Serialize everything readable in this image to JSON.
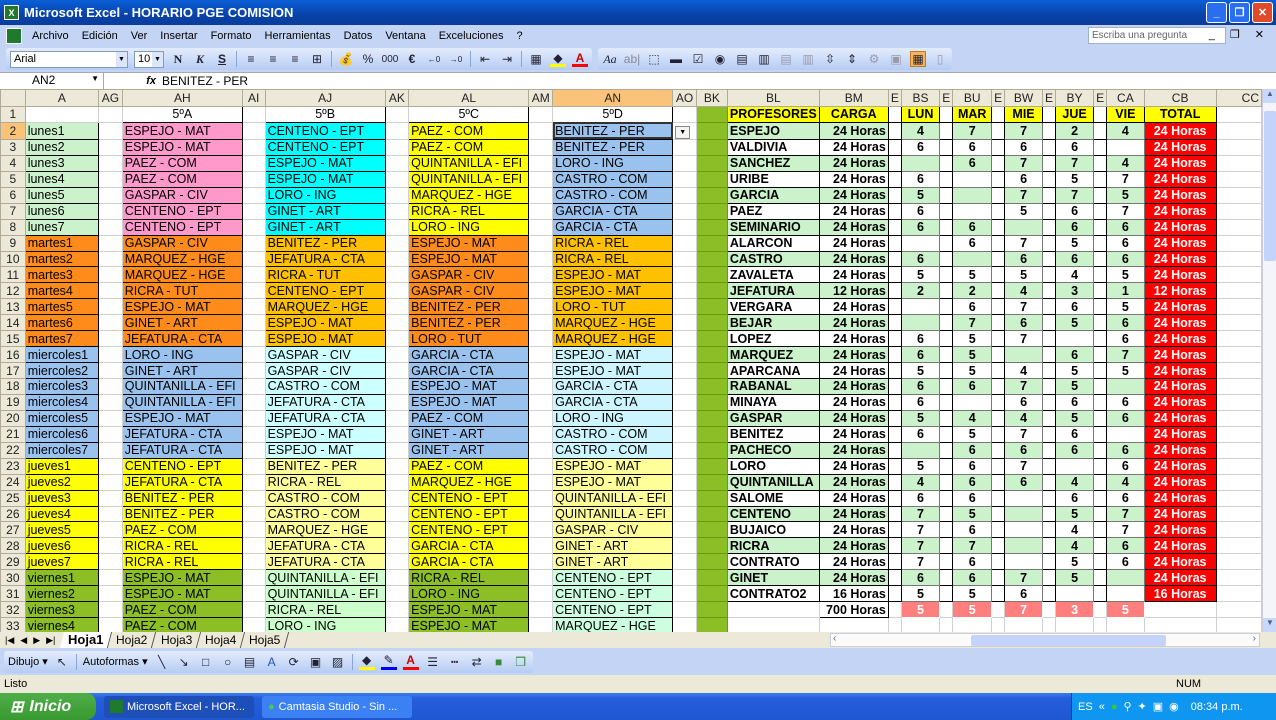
{
  "window": {
    "title": "Microsoft Excel - HORARIO PGE COMISION"
  },
  "menu": {
    "items": [
      "Archivo",
      "Edición",
      "Ver",
      "Insertar",
      "Formato",
      "Herramientas",
      "Datos",
      "Ventana",
      "Exceluciones",
      "?"
    ],
    "ask_placeholder": "Escriba una pregunta"
  },
  "format_toolbar": {
    "font": "Arial",
    "size": "10",
    "bold": "N",
    "italic": "K",
    "underline": "S",
    "percent": "%",
    "thousands": "000",
    "euro": "€"
  },
  "formula_bar": {
    "name_box": "AN2",
    "fx": "fx",
    "value": "BENITEZ - PER"
  },
  "columns": {
    "left": [
      "A",
      "AG",
      "AH",
      "AI",
      "AJ",
      "AK",
      "AL",
      "AM",
      "AN",
      "AO",
      "BK"
    ],
    "right": [
      "BL",
      "BM",
      "E",
      "BS",
      "E",
      "BU",
      "E",
      "BW",
      "E",
      "BY",
      "E",
      "CA",
      "CB",
      "CC"
    ]
  },
  "classes": [
    "5ºA",
    "5ºB",
    "5ºC",
    "5ºD"
  ],
  "rows": [
    {
      "n": "2",
      "slot": "lunes1",
      "a": "ESPEJO - MAT",
      "b": "CENTENO - EPT",
      "c": "PAEZ - COM",
      "d": "BENITEZ - PER"
    },
    {
      "n": "3",
      "slot": "lunes2",
      "a": "ESPEJO - MAT",
      "b": "CENTENO - EPT",
      "c": "PAEZ - COM",
      "d": "BENITEZ - PER"
    },
    {
      "n": "4",
      "slot": "lunes3",
      "a": "PAEZ - COM",
      "b": "ESPEJO - MAT",
      "c": "QUINTANILLA - EFI",
      "d": "LORO - ING"
    },
    {
      "n": "5",
      "slot": "lunes4",
      "a": "PAEZ - COM",
      "b": "ESPEJO - MAT",
      "c": "QUINTANILLA - EFI",
      "d": "CASTRO - COM"
    },
    {
      "n": "6",
      "slot": "lunes5",
      "a": "GASPAR - CIV",
      "b": "LORO - ING",
      "c": "MARQUEZ - HGE",
      "d": "CASTRO - COM"
    },
    {
      "n": "7",
      "slot": "lunes6",
      "a": "CENTENO - EPT",
      "b": "GINET - ART",
      "c": "RICRA - REL",
      "d": "GARCIA - CTA"
    },
    {
      "n": "8",
      "slot": "lunes7",
      "a": "CENTENO - EPT",
      "b": "GINET - ART",
      "c": "LORO - ING",
      "d": "GARCIA - CTA"
    },
    {
      "n": "9",
      "slot": "martes1",
      "a": "GASPAR - CIV",
      "b": "BENITEZ - PER",
      "c": "ESPEJO - MAT",
      "d": "RICRA - REL"
    },
    {
      "n": "10",
      "slot": "martes2",
      "a": "MARQUEZ - HGE",
      "b": "JEFATURA - CTA",
      "c": "ESPEJO - MAT",
      "d": "RICRA - REL"
    },
    {
      "n": "11",
      "slot": "martes3",
      "a": "MARQUEZ - HGE",
      "b": "RICRA - TUT",
      "c": "GASPAR - CIV",
      "d": "ESPEJO - MAT"
    },
    {
      "n": "12",
      "slot": "martes4",
      "a": "RICRA - TUT",
      "b": "CENTENO - EPT",
      "c": "GASPAR - CIV",
      "d": "ESPEJO - MAT"
    },
    {
      "n": "13",
      "slot": "martes5",
      "a": "ESPEJO - MAT",
      "b": "MARQUEZ - HGE",
      "c": "BENITEZ - PER",
      "d": "LORO - TUT"
    },
    {
      "n": "14",
      "slot": "martes6",
      "a": "GINET - ART",
      "b": "ESPEJO - MAT",
      "c": "BENITEZ - PER",
      "d": "MARQUEZ - HGE"
    },
    {
      "n": "15",
      "slot": "martes7",
      "a": "JEFATURA - CTA",
      "b": "ESPEJO - MAT",
      "c": "LORO - TUT",
      "d": "MARQUEZ - HGE"
    },
    {
      "n": "16",
      "slot": "miercoles1",
      "a": "LORO - ING",
      "b": "GASPAR - CIV",
      "c": "GARCIA - CTA",
      "d": "ESPEJO - MAT"
    },
    {
      "n": "17",
      "slot": "miercoles2",
      "a": "GINET - ART",
      "b": "GASPAR - CIV",
      "c": "GARCIA - CTA",
      "d": "ESPEJO - MAT"
    },
    {
      "n": "18",
      "slot": "miercoles3",
      "a": "QUINTANILLA - EFI",
      "b": "CASTRO - COM",
      "c": "ESPEJO - MAT",
      "d": "GARCIA - CTA"
    },
    {
      "n": "19",
      "slot": "miercoles4",
      "a": "QUINTANILLA - EFI",
      "b": "JEFATURA - CTA",
      "c": "ESPEJO - MAT",
      "d": "GARCIA - CTA"
    },
    {
      "n": "20",
      "slot": "miercoles5",
      "a": "ESPEJO - MAT",
      "b": "JEFATURA - CTA",
      "c": "PAEZ - COM",
      "d": "LORO - ING"
    },
    {
      "n": "21",
      "slot": "miercoles6",
      "a": "JEFATURA - CTA",
      "b": "ESPEJO - MAT",
      "c": "GINET - ART",
      "d": "CASTRO - COM"
    },
    {
      "n": "22",
      "slot": "miercoles7",
      "a": "JEFATURA - CTA",
      "b": "ESPEJO - MAT",
      "c": "GINET - ART",
      "d": "CASTRO - COM"
    },
    {
      "n": "23",
      "slot": "jueves1",
      "a": "CENTENO - EPT",
      "b": "BENITEZ - PER",
      "c": "PAEZ - COM",
      "d": "ESPEJO - MAT"
    },
    {
      "n": "24",
      "slot": "jueves2",
      "a": "JEFATURA - CTA",
      "b": "RICRA - REL",
      "c": "MARQUEZ - HGE",
      "d": "ESPEJO - MAT"
    },
    {
      "n": "25",
      "slot": "jueves3",
      "a": "BENITEZ - PER",
      "b": "CASTRO - COM",
      "c": "CENTENO - EPT",
      "d": "QUINTANILLA - EFI"
    },
    {
      "n": "26",
      "slot": "jueves4",
      "a": "BENITEZ - PER",
      "b": "CASTRO - COM",
      "c": "CENTENO - EPT",
      "d": "QUINTANILLA - EFI"
    },
    {
      "n": "27",
      "slot": "jueves5",
      "a": "PAEZ - COM",
      "b": "MARQUEZ - HGE",
      "c": "CENTENO - EPT",
      "d": "GASPAR - CIV"
    },
    {
      "n": "28",
      "slot": "jueves6",
      "a": "RICRA - REL",
      "b": "JEFATURA - CTA",
      "c": "GARCIA - CTA",
      "d": "GINET - ART"
    },
    {
      "n": "29",
      "slot": "jueves7",
      "a": "RICRA - REL",
      "b": "JEFATURA - CTA",
      "c": "GARCIA - CTA",
      "d": "GINET - ART"
    },
    {
      "n": "30",
      "slot": "viernes1",
      "a": "ESPEJO - MAT",
      "b": "QUINTANILLA - EFI",
      "c": "RICRA - REL",
      "d": "CENTENO - EPT"
    },
    {
      "n": "31",
      "slot": "viernes2",
      "a": "ESPEJO - MAT",
      "b": "QUINTANILLA - EFI",
      "c": "LORO - ING",
      "d": "CENTENO - EPT"
    },
    {
      "n": "32",
      "slot": "viernes3",
      "a": "PAEZ - COM",
      "b": "RICRA - REL",
      "c": "ESPEJO - MAT",
      "d": "CENTENO - EPT"
    },
    {
      "n": "33",
      "slot": "viernes4",
      "a": "PAEZ - COM",
      "b": "LORO - ING",
      "c": "ESPEJO - MAT",
      "d": "MARQUEZ - HGE"
    }
  ],
  "summary": {
    "headers": [
      "PROFESORES",
      "CARGA",
      "LUN",
      "MAR",
      "MIE",
      "JUE",
      "VIE",
      "TOTAL"
    ],
    "teachers": [
      {
        "name": "ESPEJO",
        "carga": "24 Horas",
        "lun": "4",
        "mar": "7",
        "mie": "7",
        "jue": "2",
        "vie": "4",
        "total": "24 Horas"
      },
      {
        "name": "VALDIVIA",
        "carga": "24 Horas",
        "lun": "6",
        "mar": "6",
        "mie": "6",
        "jue": "6",
        "vie": "",
        "total": "24 Horas"
      },
      {
        "name": "SANCHEZ",
        "carga": "24 Horas",
        "lun": "",
        "mar": "6",
        "mie": "7",
        "jue": "7",
        "vie": "4",
        "total": "24 Horas"
      },
      {
        "name": "URIBE",
        "carga": "24 Horas",
        "lun": "6",
        "mar": "",
        "mie": "6",
        "jue": "5",
        "vie": "7",
        "total": "24 Horas"
      },
      {
        "name": "GARCIA",
        "carga": "24 Horas",
        "lun": "5",
        "mar": "",
        "mie": "7",
        "jue": "7",
        "vie": "5",
        "total": "24 Horas"
      },
      {
        "name": "PAEZ",
        "carga": "24 Horas",
        "lun": "6",
        "mar": "",
        "mie": "5",
        "jue": "6",
        "vie": "7",
        "total": "24 Horas"
      },
      {
        "name": "SEMINARIO",
        "carga": "24 Horas",
        "lun": "6",
        "mar": "6",
        "mie": "",
        "jue": "6",
        "vie": "6",
        "total": "24 Horas"
      },
      {
        "name": "ALARCON",
        "carga": "24 Horas",
        "lun": "",
        "mar": "6",
        "mie": "7",
        "jue": "5",
        "vie": "6",
        "total": "24 Horas"
      },
      {
        "name": "CASTRO",
        "carga": "24 Horas",
        "lun": "6",
        "mar": "",
        "mie": "6",
        "jue": "6",
        "vie": "6",
        "total": "24 Horas"
      },
      {
        "name": "ZAVALETA",
        "carga": "24 Horas",
        "lun": "5",
        "mar": "5",
        "mie": "5",
        "jue": "4",
        "vie": "5",
        "total": "24 Horas"
      },
      {
        "name": "JEFATURA",
        "carga": "12 Horas",
        "lun": "2",
        "mar": "2",
        "mie": "4",
        "jue": "3",
        "vie": "1",
        "total": "12 Horas"
      },
      {
        "name": "VERGARA",
        "carga": "24 Horas",
        "lun": "",
        "mar": "6",
        "mie": "7",
        "jue": "6",
        "vie": "5",
        "total": "24 Horas"
      },
      {
        "name": "BEJAR",
        "carga": "24 Horas",
        "lun": "",
        "mar": "7",
        "mie": "6",
        "jue": "5",
        "vie": "6",
        "total": "24 Horas"
      },
      {
        "name": "LOPEZ",
        "carga": "24 Horas",
        "lun": "6",
        "mar": "5",
        "mie": "7",
        "jue": "",
        "vie": "6",
        "total": "24 Horas"
      },
      {
        "name": "MARQUEZ",
        "carga": "24 Horas",
        "lun": "6",
        "mar": "5",
        "mie": "",
        "jue": "6",
        "vie": "7",
        "total": "24 Horas"
      },
      {
        "name": "APARCANA",
        "carga": "24 Horas",
        "lun": "5",
        "mar": "5",
        "mie": "4",
        "jue": "5",
        "vie": "5",
        "total": "24 Horas"
      },
      {
        "name": "RABANAL",
        "carga": "24 Horas",
        "lun": "6",
        "mar": "6",
        "mie": "7",
        "jue": "5",
        "vie": "",
        "total": "24 Horas"
      },
      {
        "name": "MINAYA",
        "carga": "24 Horas",
        "lun": "6",
        "mar": "",
        "mie": "6",
        "jue": "6",
        "vie": "6",
        "total": "24 Horas"
      },
      {
        "name": "GASPAR",
        "carga": "24 Horas",
        "lun": "5",
        "mar": "4",
        "mie": "4",
        "jue": "5",
        "vie": "6",
        "total": "24 Horas"
      },
      {
        "name": "BENITEZ",
        "carga": "24 Horas",
        "lun": "6",
        "mar": "5",
        "mie": "7",
        "jue": "6",
        "vie": "",
        "total": "24 Horas"
      },
      {
        "name": "PACHECO",
        "carga": "24 Horas",
        "lun": "",
        "mar": "6",
        "mie": "6",
        "jue": "6",
        "vie": "6",
        "total": "24 Horas"
      },
      {
        "name": "LORO",
        "carga": "24 Horas",
        "lun": "5",
        "mar": "6",
        "mie": "7",
        "jue": "",
        "vie": "6",
        "total": "24 Horas"
      },
      {
        "name": "QUINTANILLA",
        "carga": "24 Horas",
        "lun": "4",
        "mar": "6",
        "mie": "6",
        "jue": "4",
        "vie": "4",
        "total": "24 Horas"
      },
      {
        "name": "SALOME",
        "carga": "24 Horas",
        "lun": "6",
        "mar": "6",
        "mie": "",
        "jue": "6",
        "vie": "6",
        "total": "24 Horas"
      },
      {
        "name": "CENTENO",
        "carga": "24 Horas",
        "lun": "7",
        "mar": "5",
        "mie": "",
        "jue": "5",
        "vie": "7",
        "total": "24 Horas"
      },
      {
        "name": "BUJAICO",
        "carga": "24 Horas",
        "lun": "7",
        "mar": "6",
        "mie": "",
        "jue": "4",
        "vie": "7",
        "total": "24 Horas"
      },
      {
        "name": "RICRA",
        "carga": "24 Horas",
        "lun": "7",
        "mar": "7",
        "mie": "",
        "jue": "4",
        "vie": "6",
        "total": "24 Horas"
      },
      {
        "name": "CONTRATO",
        "carga": "24 Horas",
        "lun": "7",
        "mar": "6",
        "mie": "",
        "jue": "5",
        "vie": "6",
        "total": "24 Horas"
      },
      {
        "name": "GINET",
        "carga": "24 Horas",
        "lun": "6",
        "mar": "6",
        "mie": "7",
        "jue": "5",
        "vie": "",
        "total": "24 Horas"
      },
      {
        "name": "CONTRATO2",
        "carga": "16 Horas",
        "lun": "5",
        "mar": "5",
        "mie": "6",
        "jue": "",
        "vie": "",
        "total": "16 Horas"
      }
    ],
    "totals": {
      "carga": "700 Horas",
      "lun": "5",
      "mar": "5",
      "mie": "7",
      "jue": "3",
      "vie": "5"
    }
  },
  "sheet_tabs": [
    "Hoja1",
    "Hoja2",
    "Hoja3",
    "Hoja4",
    "Hoja5"
  ],
  "active_sheet": "Hoja1",
  "drawing_toolbar": {
    "draw": "Dibujo ▾",
    "autoshapes": "Autoformas ▾"
  },
  "status": {
    "left": "Listo",
    "num": "NUM"
  },
  "taskbar": {
    "start": "Inicio",
    "tasks": [
      "Microsoft Excel - HOR...",
      "Camtasia Studio - Sin ..."
    ],
    "lang": "ES",
    "clock": "08:34 p.m."
  },
  "colors": {
    "lunes": "#ccf2cc",
    "martes": "#ff8c1a",
    "miercoles": "#99c2ee",
    "jueves": "#ffff00",
    "viernes": "#8cbf26",
    "a_lunes": "#ff99cc",
    "b_lunes": "#00ffff",
    "b_martes": "#ffc000",
    "b_miercoles": "#ccffff",
    "b_jueves": "#ffff99",
    "b_viernes": "#ccffcc",
    "c_lunes": "#ffff00",
    "d_lunes": "#99c2ee",
    "d_martes": "#ffc000",
    "d_miercoles": "#ccf5ff",
    "d_jueves": "#ffff99",
    "d_viernes": "#ccffe0",
    "header_yellow": "#ffff00",
    "total_red": "#ff0000",
    "stripe_green": "#ccf2cc",
    "totals_pink": "#ff7f7f",
    "bk_green": "#8cbf26"
  }
}
